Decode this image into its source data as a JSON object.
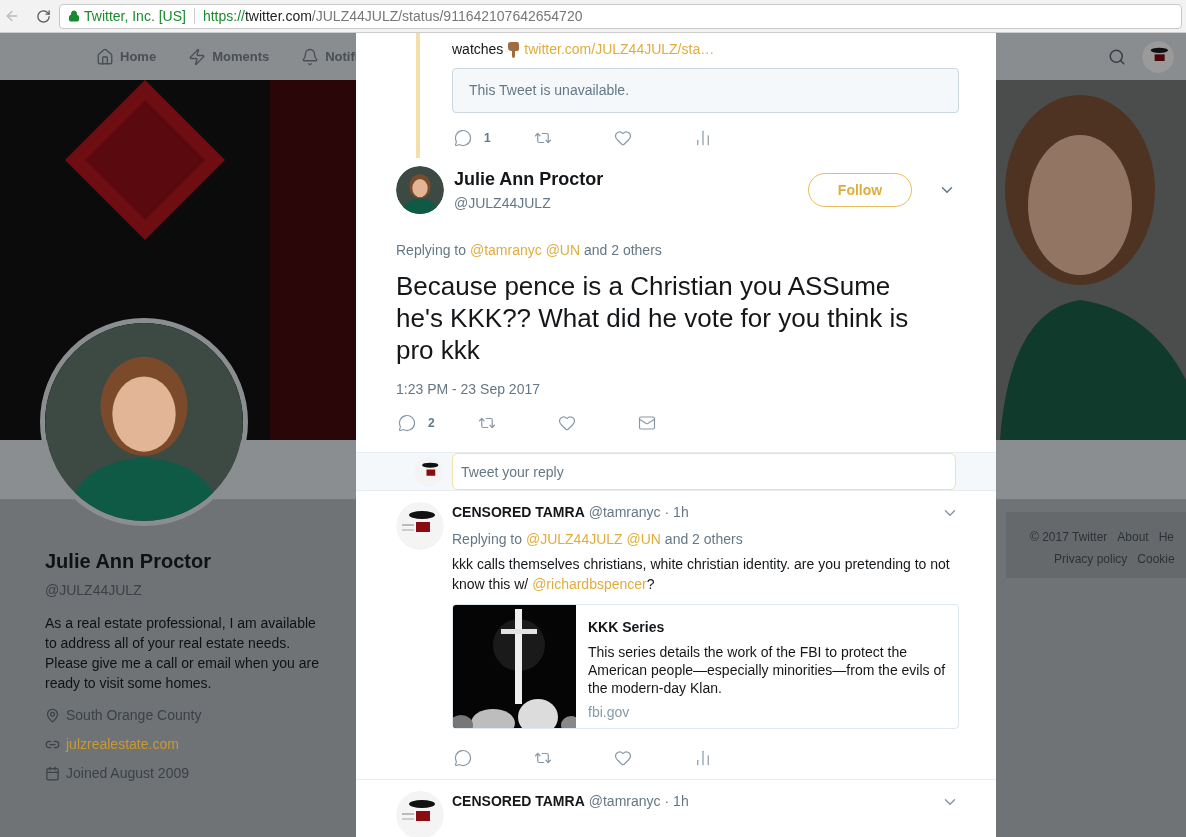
{
  "browser": {
    "site_identity": "Twitter, Inc. [US]",
    "url": {
      "scheme": "https://",
      "host": "twitter.com",
      "path": "/JULZ44JULZ/status/911642107642654720"
    }
  },
  "nav": {
    "items": [
      {
        "label": "Home"
      },
      {
        "label": "Moments"
      },
      {
        "label": "Notifi"
      }
    ]
  },
  "profile": {
    "name": "Julie Ann Proctor",
    "handle": "@JULZ44JULZ",
    "bio": "As a real estate professional, I am available to address all of your real estate needs. Please give me a call or email when you are ready to visit some homes.",
    "location": "South Orange County",
    "website": "julzrealestate.com",
    "joined": "Joined August 2009"
  },
  "footer": {
    "lines": [
      [
        "© 2017 Twitter",
        "About",
        "He"
      ],
      [
        "Privacy policy",
        "Cookie"
      ]
    ]
  },
  "modal": {
    "thread_tweet": {
      "text": "watches",
      "link": "twitter.com/JULZ44JULZ/sta…",
      "quote": "This Tweet is unavailable.",
      "actions": [
        {
          "kind": "reply",
          "count": "1"
        },
        {
          "kind": "retweet"
        },
        {
          "kind": "like"
        },
        {
          "kind": "analytics"
        }
      ]
    },
    "main_tweet": {
      "name": "Julie Ann Proctor",
      "handle": "@JULZ44JULZ",
      "follow": "Follow",
      "replying": {
        "prefix": "Replying to",
        "mentions": [
          "@tamranyc",
          "@UN"
        ],
        "suffix": "and 2 others"
      },
      "text": "Because pence is a Christian you ASSume he's KKK?? What did he vote for you think is pro kkk",
      "timestamp": "1:23 PM - 23 Sep 2017",
      "actions": [
        {
          "kind": "reply",
          "count": "2"
        },
        {
          "kind": "retweet"
        },
        {
          "kind": "like"
        },
        {
          "kind": "message"
        }
      ]
    },
    "reply_box": {
      "placeholder": "Tweet your reply"
    },
    "replies": [
      {
        "name": "CENSORED TAMRA",
        "handle": "@tamranyc",
        "time": "· 1h",
        "replying": {
          "prefix": "Replying to",
          "mentions": [
            "@JULZ44JULZ",
            "@UN"
          ],
          "suffix": "and 2 others"
        },
        "text": [
          {
            "kind": "text",
            "text": "kkk calls themselves christians, white christian identity. are you pretending to not know this w/ "
          },
          {
            "kind": "mention",
            "text": "@richardbspencer"
          },
          {
            "kind": "text",
            "text": "?"
          }
        ],
        "card": {
          "title": "KKK Series",
          "description": "This series details the work of the FBI to protect the American people—especially minorities—from the evils of the modern-day Klan.",
          "domain": "fbi.gov"
        },
        "actions": [
          {
            "kind": "reply"
          },
          {
            "kind": "retweet"
          },
          {
            "kind": "like"
          },
          {
            "kind": "analytics"
          }
        ]
      },
      {
        "name": "CENSORED TAMRA",
        "handle": "@tamranyc",
        "time": "· 1h"
      }
    ]
  }
}
